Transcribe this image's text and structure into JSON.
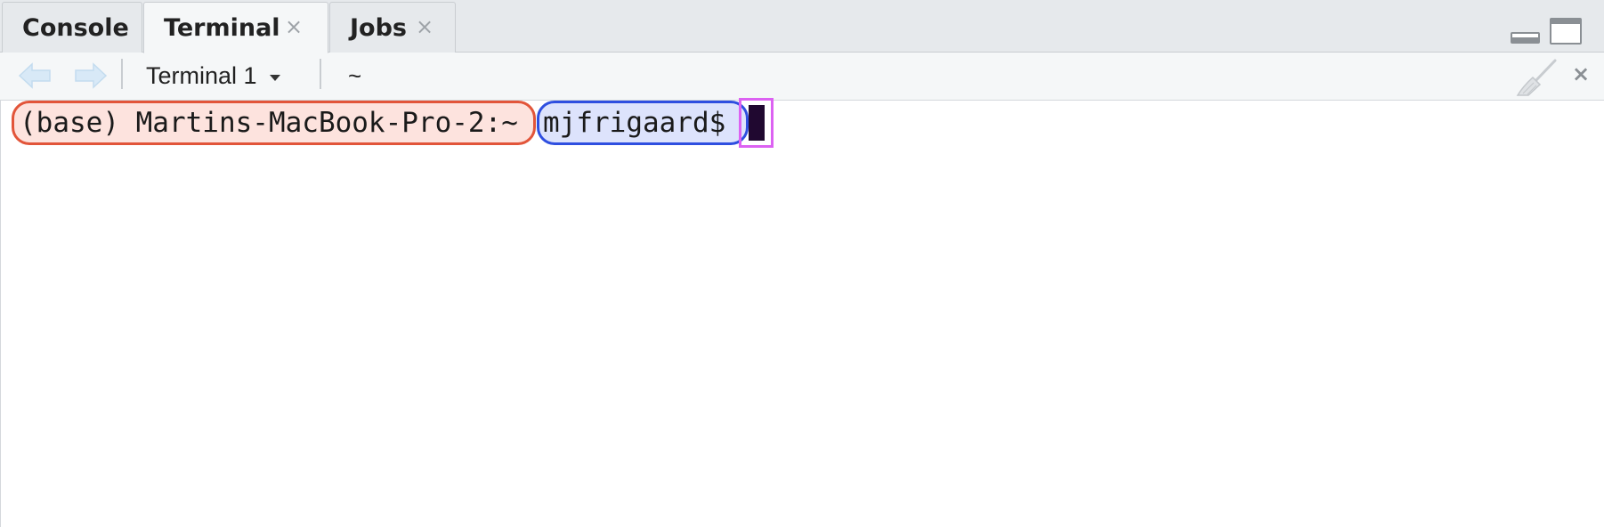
{
  "tabs": [
    {
      "label": "Console",
      "active": false,
      "closable": false
    },
    {
      "label": "Terminal",
      "active": true,
      "closable": true
    },
    {
      "label": "Jobs",
      "active": false,
      "closable": true
    }
  ],
  "tab_close_glyph": "×",
  "window_controls": {
    "minimize": "minimize-icon",
    "maximize": "maximize-icon"
  },
  "toolbar": {
    "back_icon": "back-arrow-icon",
    "forward_icon": "forward-arrow-icon",
    "terminal_select": "Terminal 1",
    "cwd": "~",
    "clear_icon": "broom-icon",
    "close_glyph": "×"
  },
  "terminal": {
    "host_prompt": "(base) Martins-MacBook-Pro-2:~",
    "user_prompt": "mjfrigaard$",
    "colors": {
      "host_highlight": "#e2553a",
      "user_highlight": "#2f4fe0",
      "cursor_highlight": "#dc62f2"
    }
  }
}
